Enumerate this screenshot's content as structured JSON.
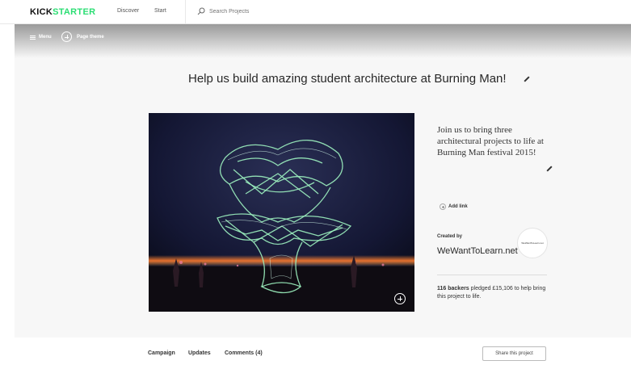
{
  "header": {
    "logo_part1": "KICK",
    "logo_part2": "STARTER",
    "nav": [
      "Discover",
      "Start"
    ],
    "search_placeholder": "Search Projects"
  },
  "editor_bar": {
    "menu_label": "Menu",
    "page_theme_label": "Page theme"
  },
  "project": {
    "title": "Help us build amazing student architecture at Burning Man!",
    "blurb": "Join us to bring three architectural projects to life at Burning Man festival 2015!",
    "add_link_label": "Add link",
    "created_by_label": "Created by",
    "creator_name": "WeWantToLearn.net",
    "avatar_text": "WeWantToLearn.net",
    "backers_count": "116 backers",
    "backers_text": " pledged £15,106 to help bring this project to life."
  },
  "tabs": {
    "items": [
      "Campaign",
      "Updates",
      "Comments (4)"
    ],
    "share_label": "Share this project"
  },
  "colors": {
    "brand_green": "#2bde73",
    "light_trail": "#9df3c0"
  }
}
